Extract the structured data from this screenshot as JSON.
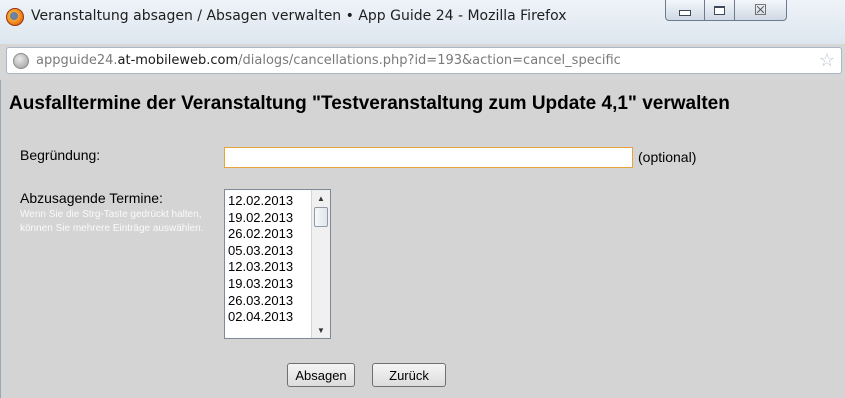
{
  "window": {
    "title": "Veranstaltung absagen / Absagen verwalten • App Guide 24 - Mozilla Firefox",
    "app_icon": "firefox-icon",
    "controls": [
      "minimize-icon",
      "maximize-icon",
      "close-icon"
    ],
    "close_glyph": "☒"
  },
  "urlbar": {
    "prefix": "appguide24.",
    "domain": "at-mobileweb.com",
    "path": "/dialogs/cancellations.php?id=193&action=cancel_specific",
    "site_icon": "globe-icon",
    "bookmark_icon": "star-icon",
    "bookmark_glyph": "☆"
  },
  "page": {
    "title": "Ausfalltermine der Veranstaltung \"Testveranstaltung zum Update 4,1\" verwalten",
    "reason": {
      "label": "Begründung:",
      "value": "",
      "suffix": "(optional)"
    },
    "dates": {
      "label": "Abzusagende Termine:",
      "hint": "Wenn Sie die Strg-Taste gedrückt halten, können Sie mehrere Einträge auswählen.",
      "items": [
        "12.02.2013",
        "19.02.2013",
        "26.02.2013",
        "05.03.2013",
        "12.03.2013",
        "19.03.2013",
        "26.03.2013",
        "02.04.2013"
      ],
      "scroll_up_glyph": "▲",
      "scroll_down_glyph": "▼"
    },
    "buttons": {
      "cancel": "Absagen",
      "back": "Zurück"
    }
  }
}
